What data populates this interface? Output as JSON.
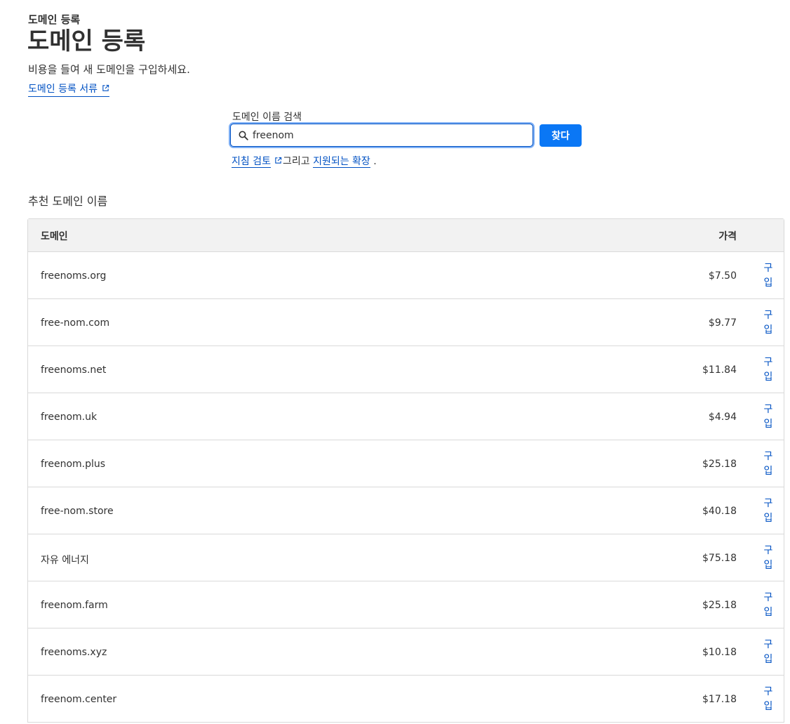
{
  "header": {
    "breadcrumb": "도메인 등록",
    "title": "도메인 등록",
    "subtitle": "비용을 들여 새 도메인을 구입하세요.",
    "docs_link": "도메인 등록 서류"
  },
  "search": {
    "label": "도메인 이름 검색",
    "value": "freenom",
    "button": "찾다",
    "hint_link1": "지침 검토",
    "hint_middle": "그리고",
    "hint_link2": "지원되는 확장",
    "hint_end": "."
  },
  "suggestions": {
    "title": "추천 도메인 이름",
    "columns": {
      "domain": "도메인",
      "price": "가격"
    },
    "buy_label": "구입",
    "rows": [
      {
        "domain": "freenoms.org",
        "price": "$7.50"
      },
      {
        "domain": "free-nom.com",
        "price": "$9.77"
      },
      {
        "domain": "freenoms.net",
        "price": "$11.84"
      },
      {
        "domain": "freenom.uk",
        "price": "$4.94"
      },
      {
        "domain": "freenom.plus",
        "price": "$25.18"
      },
      {
        "domain": "free-nom.store",
        "price": "$40.18"
      },
      {
        "domain": "자유 에너지",
        "price": "$75.18"
      },
      {
        "domain": "freenom.farm",
        "price": "$25.18"
      },
      {
        "domain": "freenoms.xyz",
        "price": "$10.18"
      },
      {
        "domain": "freenom.center",
        "price": "$17.18"
      }
    ]
  },
  "colors": {
    "link": "#0051c3",
    "primary_button": "#0a77f5",
    "text": "#313131",
    "table_header_bg": "#f2f2f2",
    "border": "#d9d9d9"
  },
  "icons": {
    "external": "external-link-icon",
    "search": "magnifier-icon"
  }
}
